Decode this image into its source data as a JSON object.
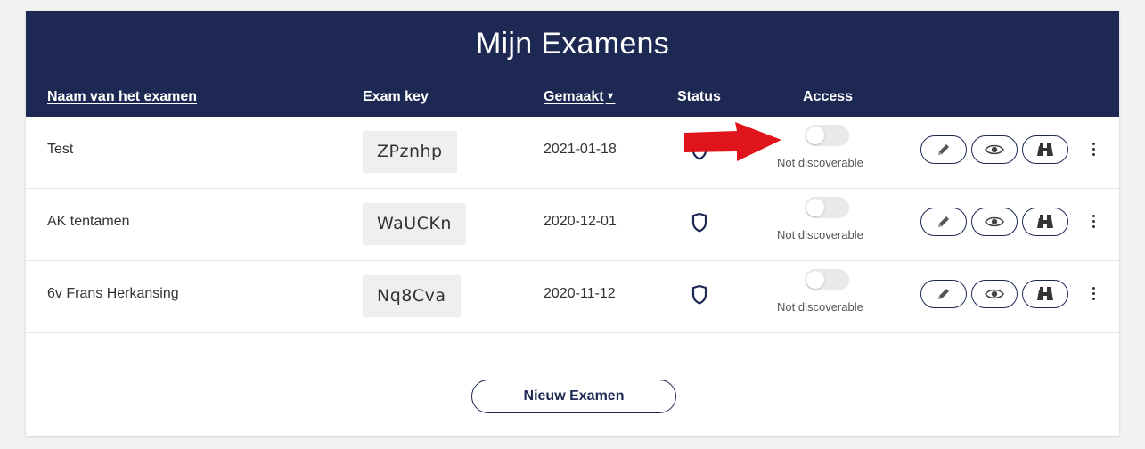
{
  "header": {
    "title": "Mijn Examens",
    "columns": {
      "name": "Naam van het examen",
      "key": "Exam key",
      "created": "Gemaakt",
      "status": "Status",
      "access": "Access"
    }
  },
  "rows": [
    {
      "name": "Test",
      "key": "ZPznhp",
      "date": "2021-01-18",
      "access": "Not discoverable"
    },
    {
      "name": "AK tentamen",
      "key": "WaUCKn",
      "date": "2020-12-01",
      "access": "Not discoverable"
    },
    {
      "name": "6v Frans Herkansing",
      "key": "Nq8Cva",
      "date": "2020-11-12",
      "access": "Not discoverable"
    }
  ],
  "actions": {
    "new_exam": "Nieuw Examen"
  },
  "icons": {
    "sort": "caret-down-icon",
    "status": "shield-icon",
    "edit": "pencil-icon",
    "view": "eye-icon",
    "inspect": "binoculars-icon",
    "more": "kebab-menu-icon"
  },
  "colors": {
    "header_bg": "#1d2953",
    "annotation_arrow": "#e0141b",
    "toggle_off": "#e9e9e9"
  }
}
